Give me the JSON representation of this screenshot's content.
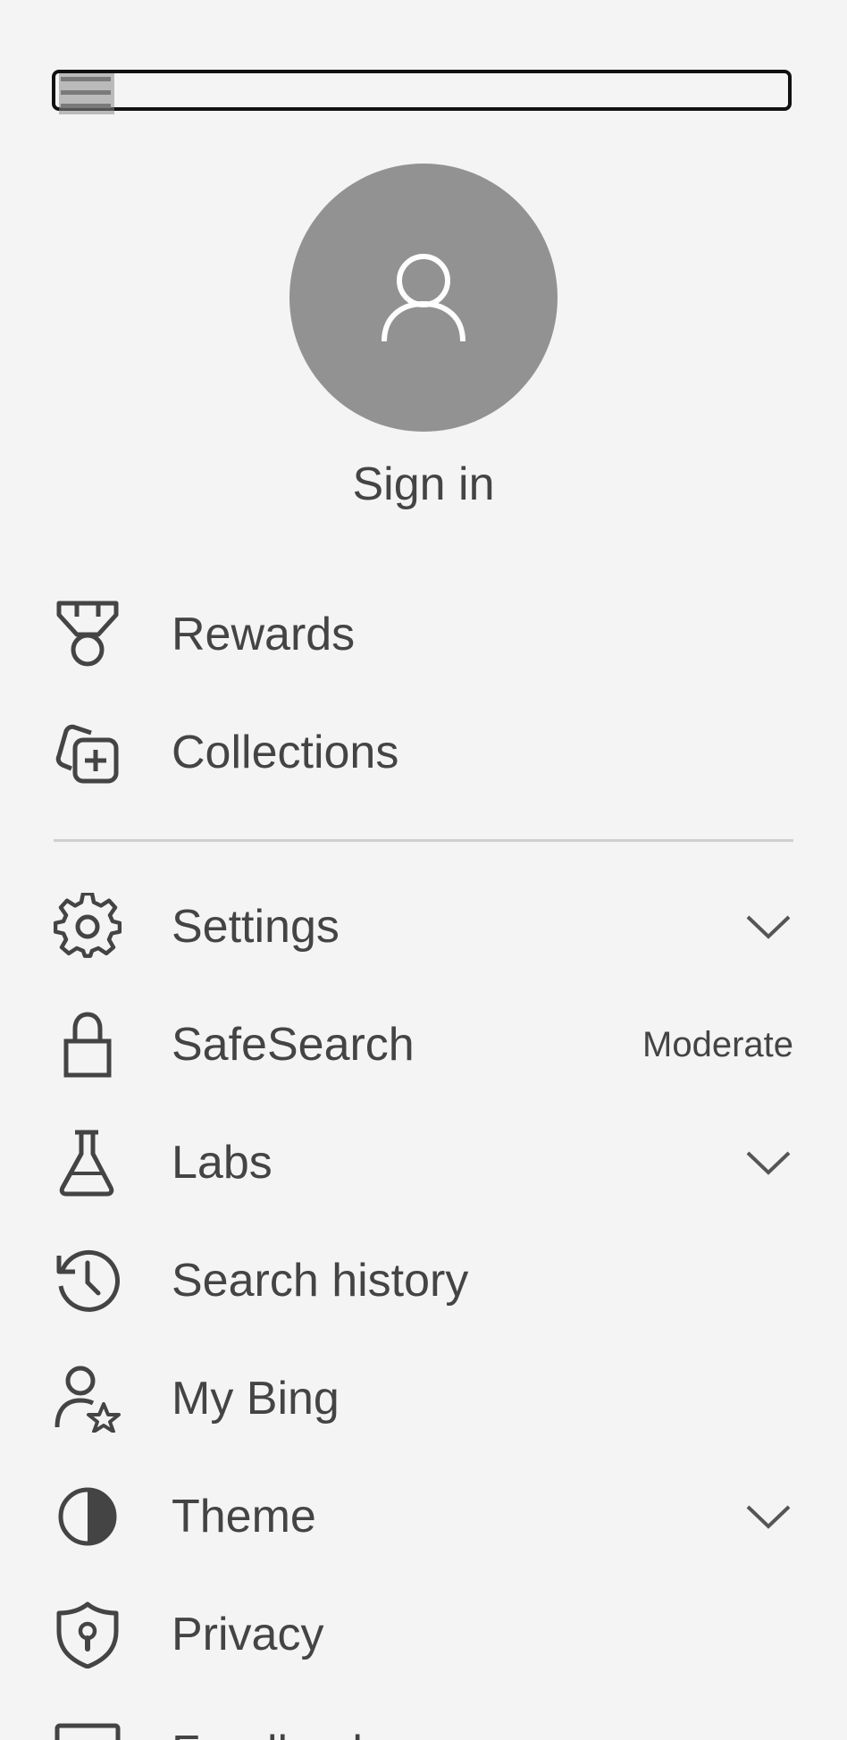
{
  "top_bar": {
    "menu_icon": "hamburger-menu-icon"
  },
  "profile": {
    "avatar_icon": "person-icon",
    "sign_in_label": "Sign in"
  },
  "primary_items": [
    {
      "label": "Rewards",
      "icon": "medal-icon"
    },
    {
      "label": "Collections",
      "icon": "collections-add-icon"
    }
  ],
  "secondary_items": [
    {
      "label": "Settings",
      "icon": "gear-icon",
      "trailing": "chevron-down-icon"
    },
    {
      "label": "SafeSearch",
      "icon": "lock-icon",
      "value": "Moderate"
    },
    {
      "label": "Labs",
      "icon": "flask-icon",
      "trailing": "chevron-down-icon"
    },
    {
      "label": "Search history",
      "icon": "history-icon"
    },
    {
      "label": "My Bing",
      "icon": "person-star-icon"
    },
    {
      "label": "Theme",
      "icon": "contrast-icon",
      "trailing": "chevron-down-icon"
    },
    {
      "label": "Privacy",
      "icon": "shield-keyhole-icon"
    },
    {
      "label": "Feedback",
      "icon": "feedback-icon"
    }
  ],
  "colors": {
    "background": "#f4f4f4",
    "text": "#444444",
    "avatar": "#929292",
    "divider": "#cfcfcf"
  }
}
